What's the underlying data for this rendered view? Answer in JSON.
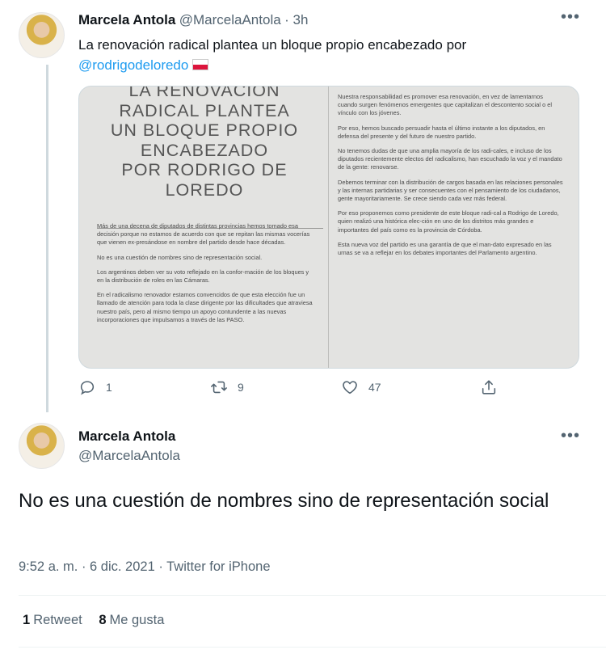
{
  "tweet1": {
    "name": "Marcela Antola",
    "handle": "@MarcelaAntola",
    "time": "· 3h",
    "text": "La renovación radical plantea un bloque propio encabezado por",
    "mention": "@rodrigodeloredo",
    "image": {
      "headline": [
        "LA RENOVACION",
        "RADICAL PLANTEA",
        "UN BLOQUE PROPIO",
        "ENCABEZADO",
        "POR RODRIGO DE",
        "LOREDO"
      ],
      "left_paragraphs": [
        "Más de una decena de diputados de distintas provincias hemos tomado esa decisión porque no estamos de acuerdo con que se repitan las mismas vocerías que vienen ex-presándose en nombre del partido desde hace décadas.",
        "No es una cuestión de nombres sino de representación social.",
        "Los argentinos deben ver su voto reflejado en la confor-mación de los bloques y en la distribución de roles en las Cámaras.",
        "En el radicalismo renovador estamos convencidos de que esta elección fue un llamado de atención para toda la clase dirigente por las dificultades que atraviesa nuestro país, pero al mismo tiempo un apoyo contundente a las nuevas incorporaciones que impulsamos a través de las PASO."
      ],
      "right_paragraphs": [
        "Nuestra responsabilidad es promover esa renovación, en vez de lamentarnos cuando surgen fenómenos emergentes que capitalizan el descontento social o el vínculo con los jóvenes.",
        "Por eso, hemos buscado persuadir hasta el último instante a los diputados, en defensa del presente y del futuro de nuestro partido.",
        "No tenemos dudas de que una amplia mayoría de los radi-cales, e incluso de los diputados recientemente electos del radicalismo, han escuchado la voz y el mandato de la gente: renovarse.",
        "Debemos terminar con la distribución de cargos basada en las relaciones personales y las internas partidarias y ser consecuentes con el pensamiento de los ciudadanos, gente mayoritariamente. Se crece siendo cada vez más federal.",
        "Por eso proponemos como presidente de este bloque radi-cal a Rodrigo de Loredo, quien realizó una histórica elec-ción en uno de los distritos más grandes e importantes del país como es la provincia de Córdoba.",
        "Esta nueva voz del partido es una garantía de que el man-dato expresado en las urnas se va a reflejar en los debates importantes del Parlamento argentino."
      ]
    },
    "actions": {
      "replies": "1",
      "retweets": "9",
      "likes": "47"
    }
  },
  "tweet2": {
    "name": "Marcela Antola",
    "handle": "@MarcelaAntola",
    "text": "No es una cuestión de nombres sino de representación social",
    "meta": "9:52 a. m. · 6 dic. 2021 · Twitter for iPhone",
    "stats": {
      "retweets_count": "1",
      "retweets_label": "Retweet",
      "likes_count": "8",
      "likes_label": "Me gusta"
    }
  },
  "colors": {
    "accent": "#1d9bf0",
    "muted": "#536471",
    "text": "#0f1419",
    "border": "#cfd9de"
  },
  "icons": {
    "more": "more-horizontal-icon",
    "reply": "reply-icon",
    "retweet": "retweet-icon",
    "like": "heart-icon",
    "share": "share-icon"
  }
}
